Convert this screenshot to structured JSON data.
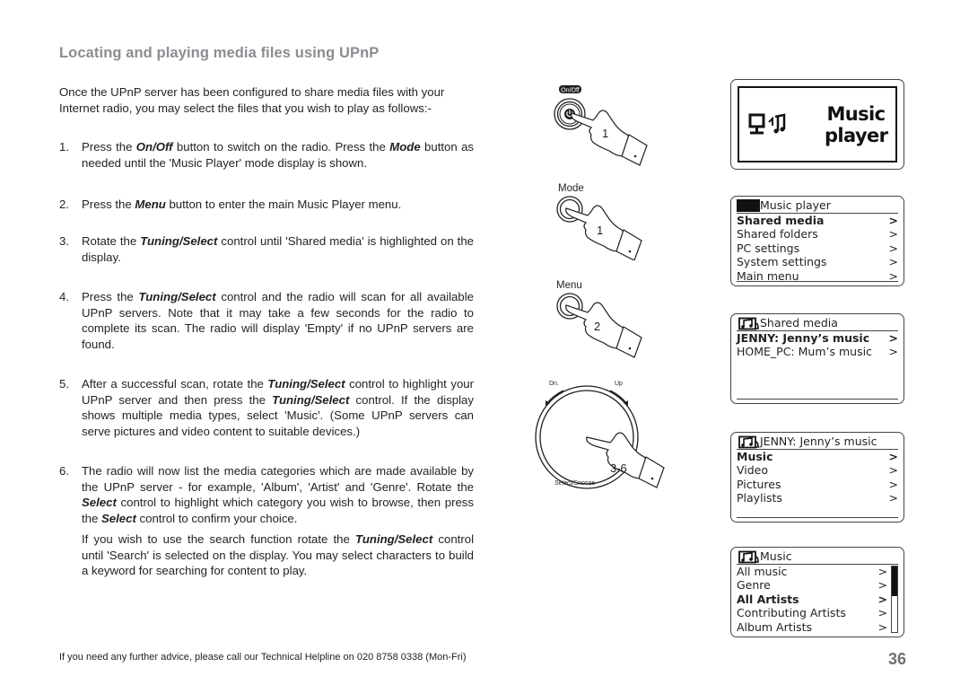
{
  "page": {
    "title": "Locating and playing media files using UPnP",
    "intro": "Once the UPnP server has been configured to share media files with your Internet radio, you may select the files that you wish to play as follows:-",
    "steps": [
      {
        "num": "1.",
        "parts": [
          "Press the ",
          "On/Off",
          " button to switch on the radio. Press the ",
          "Mode",
          " button as needed until the 'Music Player' mode display is shown."
        ]
      },
      {
        "num": "2.",
        "parts": [
          "Press the ",
          "Menu",
          " button to enter the main Music Player menu."
        ]
      },
      {
        "num": "3.",
        "parts": [
          "Rotate the ",
          "Tuning/Select",
          " control until 'Shared media' is highlighted on the display."
        ]
      },
      {
        "num": "4.",
        "parts": [
          "Press the ",
          "Tuning/Select",
          " control and the radio will scan for all available UPnP servers. Note that it may take a few seconds for the radio to complete its scan. The radio will display 'Empty' if no UPnP servers are found."
        ]
      },
      {
        "num": "5.",
        "parts": [
          "After a successful scan, rotate the ",
          "Tuning/Select",
          " control to highlight your UPnP server and then press the ",
          "Tuning/Select",
          " control. If the display shows multiple media types, select 'Music'. (Some UPnP servers can serve pictures and video content to suitable devices.)"
        ]
      },
      {
        "num": "6.",
        "parts": [
          "The radio will now list the media categories which are made available by the UPnP server - for example, 'Album', 'Artist' and 'Genre'. Rotate the ",
          "Select",
          " control to highlight which category you wish to browse, then press the ",
          "Select",
          " control to confirm your choice."
        ]
      }
    ],
    "search_note": {
      "parts": [
        "If you wish to use the search function rotate the ",
        "Tuning/Select",
        " control until 'Search' is selected on the display. You may select characters to build a keyword for searching for content to play."
      ]
    },
    "footer": "If you need any further advice, please call our Technical Helpline on 020 8758 0338 (Mon-Fri)",
    "page_number": "36"
  },
  "illustrations": {
    "onoff": {
      "button_label": "On/Off",
      "step": "1",
      "icon": "power-icon"
    },
    "mode": {
      "button_label": "Mode",
      "step": "1"
    },
    "menu": {
      "button_label": "Menu",
      "step": "2"
    },
    "dial": {
      "left_label": "Dn.",
      "right_label": "Up",
      "bottom_label": "Select/Snooze",
      "step": "3-6"
    }
  },
  "screens": {
    "splash": {
      "line1": "Music",
      "line2": "player",
      "icon": "pc-music-icon"
    },
    "music_player_menu": {
      "header": "Music player",
      "items": [
        {
          "label": "Shared media",
          "selected": true
        },
        {
          "label": "Shared folders",
          "selected": false
        },
        {
          "label": "PC settings",
          "selected": false
        },
        {
          "label": "System settings",
          "selected": false
        },
        {
          "label": "Main menu",
          "selected": false
        }
      ],
      "arrow": ">"
    },
    "shared_media": {
      "header": "Shared media",
      "icon": "music-folder-icon",
      "items": [
        {
          "label": "JENNY: Jenny’s music",
          "selected": true
        },
        {
          "label": "HOME_PC: Mum’s music",
          "selected": false
        }
      ],
      "arrow": ">"
    },
    "jenny": {
      "header": "JENNY: Jenny’s music",
      "icon": "music-folder-icon",
      "items": [
        {
          "label": "Music",
          "selected": true
        },
        {
          "label": "Video",
          "selected": false
        },
        {
          "label": "Pictures",
          "selected": false
        },
        {
          "label": "Playlists",
          "selected": false
        }
      ],
      "arrow": ">"
    },
    "music": {
      "header": "Music",
      "icon": "music-folder-icon",
      "items": [
        {
          "label": "All music",
          "selected": false
        },
        {
          "label": "Genre",
          "selected": false
        },
        {
          "label": "All Artists",
          "selected": true
        },
        {
          "label": "Contributing Artists",
          "selected": false
        },
        {
          "label": "Album Artists",
          "selected": false
        }
      ],
      "arrow": ">",
      "scroll_position": 0.45
    }
  }
}
